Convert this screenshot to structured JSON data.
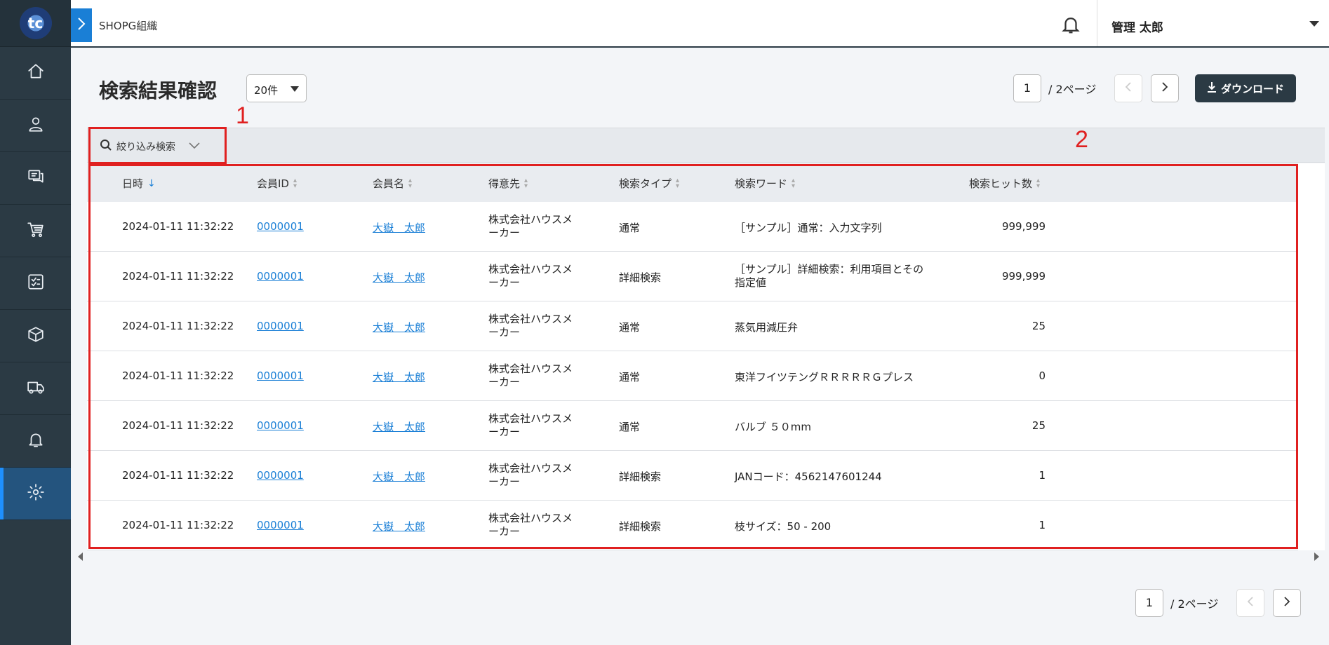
{
  "header": {
    "org_name": "SHOPG組織",
    "user_name": "管理 太郎"
  },
  "sidebar": {
    "logo_text": "tc",
    "items": [
      {
        "icon": "home-icon"
      },
      {
        "icon": "user-icon"
      },
      {
        "icon": "chat-icon"
      },
      {
        "icon": "cart-icon"
      },
      {
        "icon": "checklist-icon"
      },
      {
        "icon": "box-icon"
      },
      {
        "icon": "truck-icon"
      },
      {
        "icon": "bell-icon"
      },
      {
        "icon": "gear-icon",
        "active": true
      }
    ]
  },
  "page": {
    "title": "検索結果確認",
    "per_page": "20件",
    "current_page": "1",
    "total_pages_label": "/ 2ページ",
    "download_label": "ダウンロード",
    "filter_label": "絞り込み検索"
  },
  "annotations": {
    "label1": "1",
    "label2": "2"
  },
  "table": {
    "columns": [
      "日時",
      "会員ID",
      "会員名",
      "得意先",
      "検索タイプ",
      "検索ワード",
      "検索ヒット数"
    ],
    "rows": [
      {
        "datetime": "2024-01-11 11:32:22",
        "member_id": "0000001",
        "member_name": "大嶽　太郎",
        "customer_l1": "株式会社ハウスメ",
        "customer_l2": "ーカー",
        "type": "通常",
        "word_l1": "［サンプル］通常：入力文字列",
        "word_l2": "",
        "hits": "999,999"
      },
      {
        "datetime": "2024-01-11 11:32:22",
        "member_id": "0000001",
        "member_name": "大嶽　太郎",
        "customer_l1": "株式会社ハウスメ",
        "customer_l2": "ーカー",
        "type": "詳細検索",
        "word_l1": "［サンプル］詳細検索：利用項目とその",
        "word_l2": "指定値",
        "hits": "999,999"
      },
      {
        "datetime": "2024-01-11 11:32:22",
        "member_id": "0000001",
        "member_name": "大嶽　太郎",
        "customer_l1": "株式会社ハウスメ",
        "customer_l2": "ーカー",
        "type": "通常",
        "word_l1": "蒸気用減圧弁",
        "word_l2": "",
        "hits": "25"
      },
      {
        "datetime": "2024-01-11 11:32:22",
        "member_id": "0000001",
        "member_name": "大嶽　太郎",
        "customer_l1": "株式会社ハウスメ",
        "customer_l2": "ーカー",
        "type": "通常",
        "word_l1": "東洋フイツテングＲＲＲＲＲＧプレス",
        "word_l2": "",
        "hits": "0"
      },
      {
        "datetime": "2024-01-11 11:32:22",
        "member_id": "0000001",
        "member_name": "大嶽　太郎",
        "customer_l1": "株式会社ハウスメ",
        "customer_l2": "ーカー",
        "type": "通常",
        "word_l1": "バルブ ５０mm",
        "word_l2": "",
        "hits": "25"
      },
      {
        "datetime": "2024-01-11 11:32:22",
        "member_id": "0000001",
        "member_name": "大嶽　太郎",
        "customer_l1": "株式会社ハウスメ",
        "customer_l2": "ーカー",
        "type": "詳細検索",
        "word_l1": "JANコード：4562147601244",
        "word_l2": "",
        "hits": "1"
      },
      {
        "datetime": "2024-01-11 11:32:22",
        "member_id": "0000001",
        "member_name": "大嶽　太郎",
        "customer_l1": "株式会社ハウスメ",
        "customer_l2": "ーカー",
        "type": "詳細検索",
        "word_l1": "枝サイズ：50 - 200",
        "word_l2": "",
        "hits": "1"
      }
    ]
  }
}
